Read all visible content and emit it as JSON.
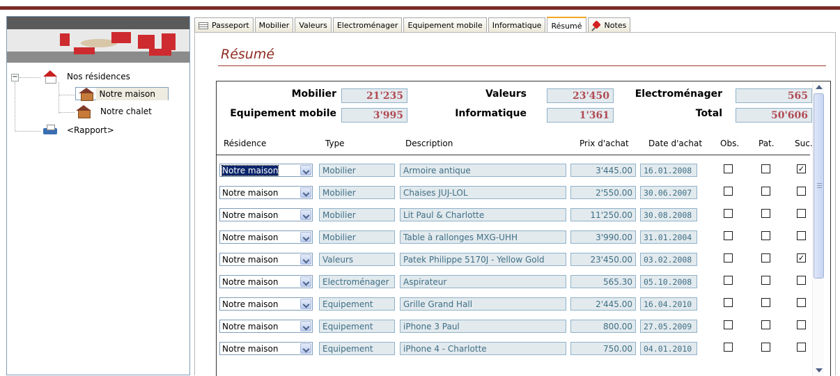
{
  "tree": {
    "root_label": "Nos résidences",
    "items": [
      {
        "label": "Notre maison",
        "selected": true
      },
      {
        "label": "Notre chalet",
        "selected": false
      }
    ],
    "report_label": "<Rapport>"
  },
  "tabs": [
    {
      "label": "Passeport",
      "active": false
    },
    {
      "label": "Mobilier",
      "active": false
    },
    {
      "label": "Valeurs",
      "active": false
    },
    {
      "label": "Electroménager",
      "active": false
    },
    {
      "label": "Equipement mobile",
      "active": false
    },
    {
      "label": "Informatique",
      "active": false
    },
    {
      "label": "Résumé",
      "active": true
    },
    {
      "label": "Notes",
      "active": false
    }
  ],
  "page_title": "Résumé",
  "summary": {
    "mobilier": {
      "label": "Mobilier",
      "value": "21'235"
    },
    "valeurs": {
      "label": "Valeurs",
      "value": "23'450"
    },
    "electromenager": {
      "label": "Electroménager",
      "value": "565"
    },
    "equipement_mobile": {
      "label": "Equipement mobile",
      "value": "3'995"
    },
    "informatique": {
      "label": "Informatique",
      "value": "1'361"
    },
    "total": {
      "label": "Total",
      "value": "50'606"
    }
  },
  "columns": {
    "residence": "Résidence",
    "type": "Type",
    "description": "Description",
    "prix": "Prix d'achat",
    "date": "Date d'achat",
    "obs": "Obs.",
    "pat": "Pat.",
    "suc": "Suc."
  },
  "rows": [
    {
      "residence": "Notre maison",
      "type": "Mobilier",
      "description": "Armoire antique",
      "prix": "3'445.00",
      "date": "16.01.2008",
      "obs": false,
      "pat": false,
      "suc": true
    },
    {
      "residence": "Notre maison",
      "type": "Mobilier",
      "description": "Chaises JUJ-LOL",
      "prix": "2'550.00",
      "date": "30.06.2007",
      "obs": false,
      "pat": false,
      "suc": false
    },
    {
      "residence": "Notre maison",
      "type": "Mobilier",
      "description": "Lit Paul & Charlotte",
      "prix": "11'250.00",
      "date": "30.08.2008",
      "obs": false,
      "pat": false,
      "suc": false
    },
    {
      "residence": "Notre maison",
      "type": "Mobilier",
      "description": "Table à rallonges MXG-UHH",
      "prix": "3'990.00",
      "date": "31.01.2004",
      "obs": false,
      "pat": false,
      "suc": false
    },
    {
      "residence": "Notre maison",
      "type": "Valeurs",
      "description": "Patek Philippe 5170J - Yellow Gold",
      "prix": "23'450.00",
      "date": "03.02.2008",
      "obs": false,
      "pat": false,
      "suc": true
    },
    {
      "residence": "Notre maison",
      "type": "Electroménager",
      "description": "Aspirateur",
      "prix": "565.30",
      "date": "05.10.2008",
      "obs": false,
      "pat": false,
      "suc": false
    },
    {
      "residence": "Notre maison",
      "type": "Equipement",
      "description": "Grille Grand Hall",
      "prix": "2'445.00",
      "date": "16.04.2010",
      "obs": false,
      "pat": false,
      "suc": false
    },
    {
      "residence": "Notre maison",
      "type": "Equipement",
      "description": "iPhone 3 Paul",
      "prix": "800.00",
      "date": "27.05.2009",
      "obs": false,
      "pat": false,
      "suc": false
    },
    {
      "residence": "Notre maison",
      "type": "Equipement",
      "description": "iPhone 4 - Charlotte",
      "prix": "750.00",
      "date": "04.01.2010",
      "obs": false,
      "pat": false,
      "suc": false
    }
  ],
  "colors": {
    "accent": "#7b2b25",
    "title": "#8e2b20",
    "summary_value": "#b04a54",
    "field_bg": "#e2eaee",
    "field_text": "#3f6e84"
  }
}
